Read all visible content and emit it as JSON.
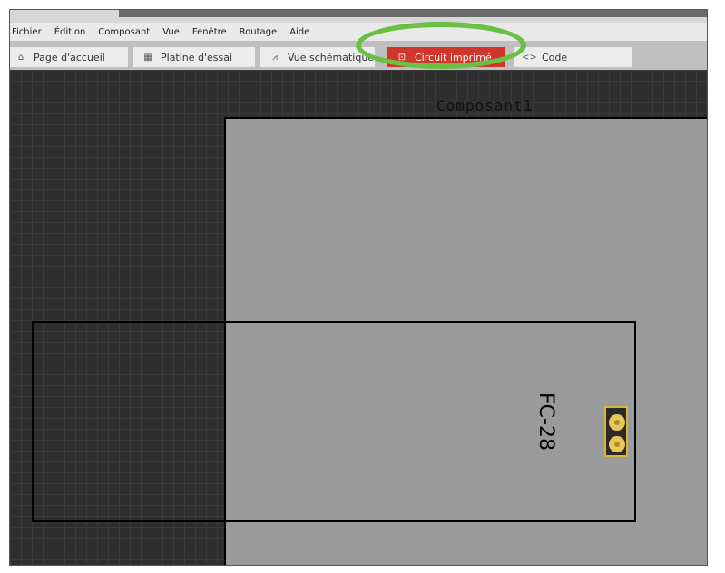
{
  "menu": [
    "Fichier",
    "Édition",
    "Composant",
    "Vue",
    "Fenêtre",
    "Routage",
    "Aide"
  ],
  "tabs": [
    {
      "label": "Page d'accueil",
      "icon": "home-icon",
      "active": false
    },
    {
      "label": "Platine d'essai",
      "icon": "breadboard-icon",
      "active": false
    },
    {
      "label": "Vue schématique",
      "icon": "schematic-icon",
      "active": false
    },
    {
      "label": "Circuit imprimé",
      "icon": "pcb-icon",
      "active": true
    },
    {
      "label": "Code",
      "icon": "code-icon",
      "active": false
    }
  ],
  "canvas": {
    "board_label": "Composant1",
    "part_label": "FC-28"
  },
  "colors": {
    "active_tab": "#d0362a",
    "highlight": "#6ac043",
    "board": "#9a9a9a"
  }
}
